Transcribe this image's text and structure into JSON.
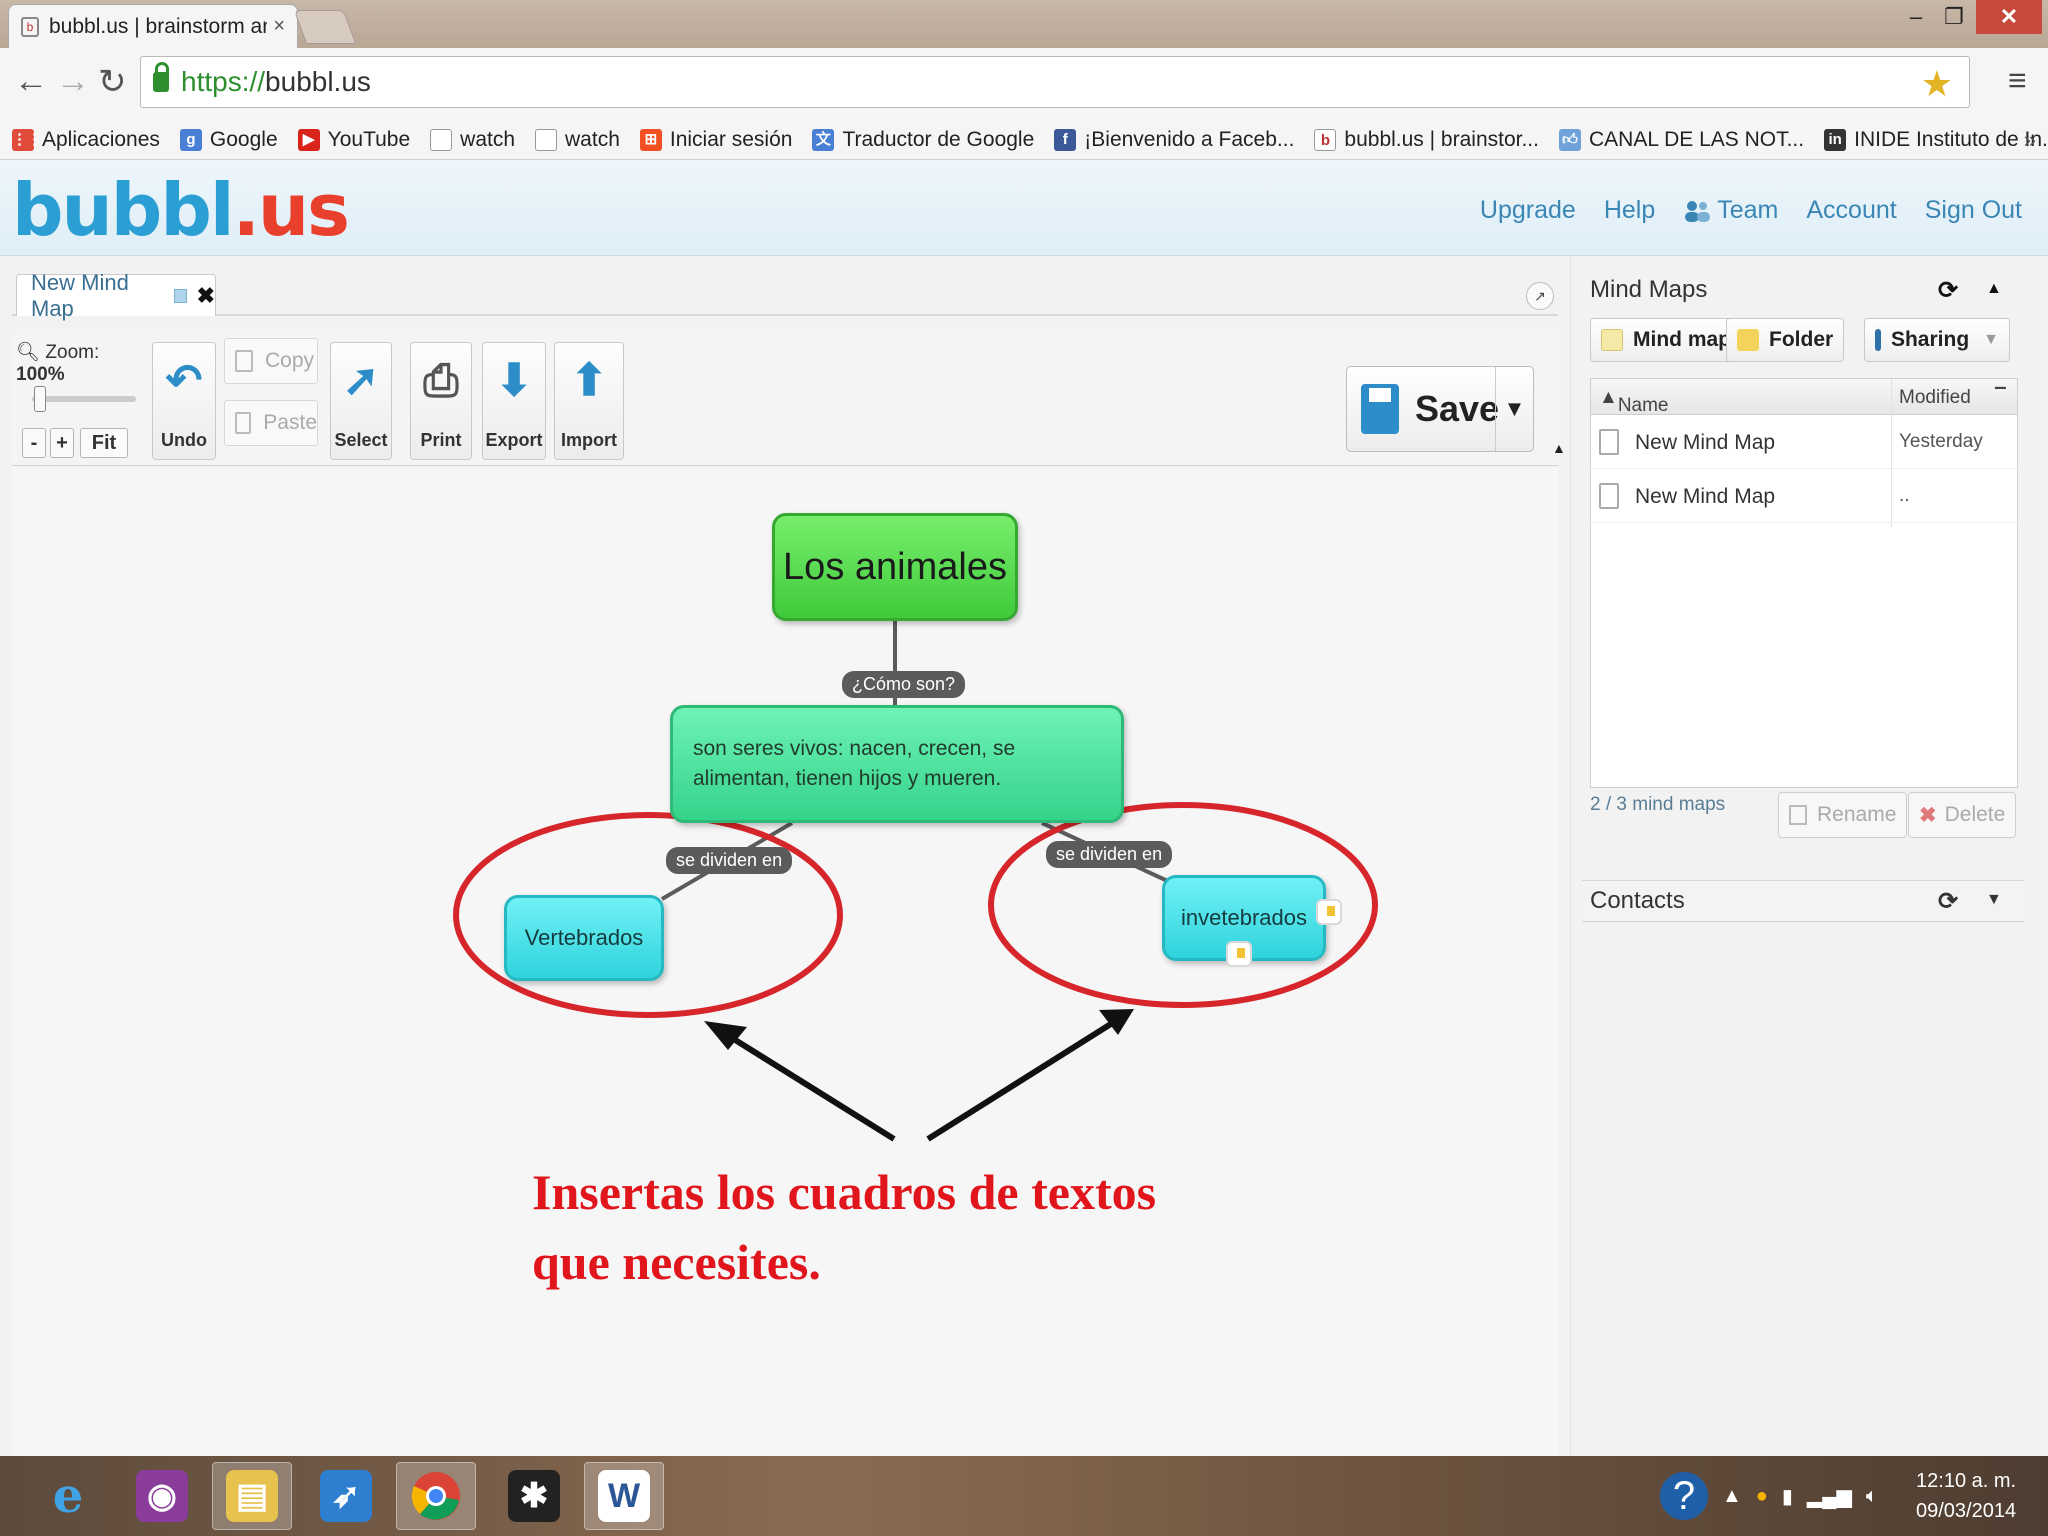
{
  "browser": {
    "tab_title": "bubbl.us | brainstorm and",
    "tab_close": "×",
    "url_scheme": "https://",
    "url_host": "bubbl.us",
    "window_controls": {
      "minimize": "–",
      "maximize": "❐",
      "close": "✕"
    }
  },
  "bookmarks": [
    {
      "label": "Aplicaciones",
      "icon": "apps-grid-icon",
      "color": "#e14b3b"
    },
    {
      "label": "Google",
      "icon": "google-icon",
      "color": "#4a7fd6"
    },
    {
      "label": "YouTube",
      "icon": "youtube-icon",
      "color": "#d8241b"
    },
    {
      "label": "watch",
      "icon": "page-icon",
      "color": "#ffffff"
    },
    {
      "label": "watch",
      "icon": "page-icon",
      "color": "#ffffff"
    },
    {
      "label": "Iniciar sesión",
      "icon": "windows-icon",
      "color": "#f25022"
    },
    {
      "label": "Traductor de Google",
      "icon": "translate-icon",
      "color": "#4a7fd6"
    },
    {
      "label": "¡Bienvenido a Faceb...",
      "icon": "facebook-icon",
      "color": "#3b5998"
    },
    {
      "label": "bubbl.us | brainstor...",
      "icon": "bubbl-icon",
      "color": "#ffffff"
    },
    {
      "label": "CANAL DE LAS NOT...",
      "icon": "thumbs-up-icon",
      "color": "#6fa2d8"
    },
    {
      "label": "INIDE Instituto de In...",
      "icon": "inide-icon",
      "color": "#333333"
    }
  ],
  "bookmarks_more": "»",
  "header": {
    "logo_part1": "bubbl",
    "logo_part2": ".us",
    "nav": [
      "Upgrade",
      "Help",
      "Team",
      "Account",
      "Sign Out"
    ]
  },
  "editor": {
    "doc_tab": "New Mind Map",
    "zoom_label": "Zoom:",
    "zoom_value": "100%",
    "zoom_minus": "-",
    "zoom_plus": "+",
    "zoom_fit": "Fit",
    "tools": {
      "undo": "Undo",
      "copy": "Copy",
      "paste": "Paste",
      "select": "Select",
      "print": "Print",
      "export": "Export",
      "import": "Import",
      "save": "Save"
    }
  },
  "mindmap": {
    "root": "Los animales",
    "root_edge_label": "¿Cómo son?",
    "middle": "son seres vivos: nacen, crecen, se alimentan, tienen hijos y mueren.",
    "left_edge_label": "se dividen en",
    "right_edge_label": "se dividen en",
    "left_node": "Vertebrados",
    "right_node": "invetebrados"
  },
  "annotation": {
    "line1": "Insertas los cuadros de textos",
    "line2": "que necesites.",
    "color": "#e0161c"
  },
  "sidebar": {
    "title": "Mind Maps",
    "buttons": {
      "mindmap": "Mind map",
      "folder": "Folder",
      "sharing": "Sharing"
    },
    "columns": {
      "name": "Name",
      "modified": "Modified"
    },
    "files": [
      {
        "name": "New Mind Map",
        "modified": "Yesterday"
      },
      {
        "name": "New Mind Map",
        "modified": ".."
      }
    ],
    "count": "2 / 3 mind maps",
    "rename": "Rename",
    "delete": "Delete",
    "contacts": "Contacts"
  },
  "taskbar": {
    "apps": [
      "internet-explorer-icon",
      "media-app-icon",
      "file-explorer-icon",
      "rocket-app-icon",
      "chrome-icon",
      "puzzle-app-icon",
      "word-icon"
    ],
    "time": "12:10 a. m.",
    "date": "09/03/2014"
  }
}
